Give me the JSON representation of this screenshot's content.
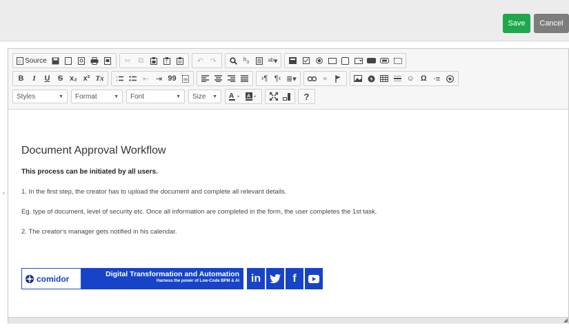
{
  "header": {
    "save_label": "Save",
    "cancel_label": "Cancel"
  },
  "toolbar": {
    "source_label": "Source",
    "combos": {
      "styles": "Styles",
      "format": "Format",
      "font": "Font",
      "size": "Size"
    },
    "row1_icons": [
      "source-icon",
      "save-doc-icon",
      "new-page-icon",
      "preview-icon",
      "print-icon",
      "templates-icon",
      "cut-icon",
      "copy-icon",
      "paste-icon",
      "paste-text-icon",
      "paste-word-icon",
      "undo-icon",
      "redo-icon",
      "find-icon",
      "replace-icon",
      "select-all-icon",
      "spellcheck-icon",
      "form-icon",
      "checkbox-icon",
      "radio-icon",
      "textfield-icon",
      "textarea-icon",
      "select-icon",
      "button-icon",
      "image-button-icon",
      "hidden-field-icon"
    ],
    "row2_labels": {
      "bold": "B",
      "italic": "I",
      "underline": "U",
      "strike": "S",
      "subscript": "x₂",
      "superscript": "x²",
      "remove_format": "Tx",
      "blockquote": "99"
    }
  },
  "document": {
    "title": "Document Approval Workflow",
    "subtitle": "This process can be initiated by all users.",
    "paragraphs": [
      "1. In the first step, the creator has to upload the document and complete all relevant details.",
      "Eg. type of document, level of security etc.  Once all information are completed in the form, the user completes the 1st task.",
      "2. The creator's manager gets notified in his calendar."
    ],
    "banner": {
      "brand": "comidor",
      "headline": "Digital Transformation and Automation",
      "tagline": "Harness the power of Low-Code BPM & AI",
      "social": [
        "in",
        "",
        "f",
        ""
      ]
    }
  }
}
